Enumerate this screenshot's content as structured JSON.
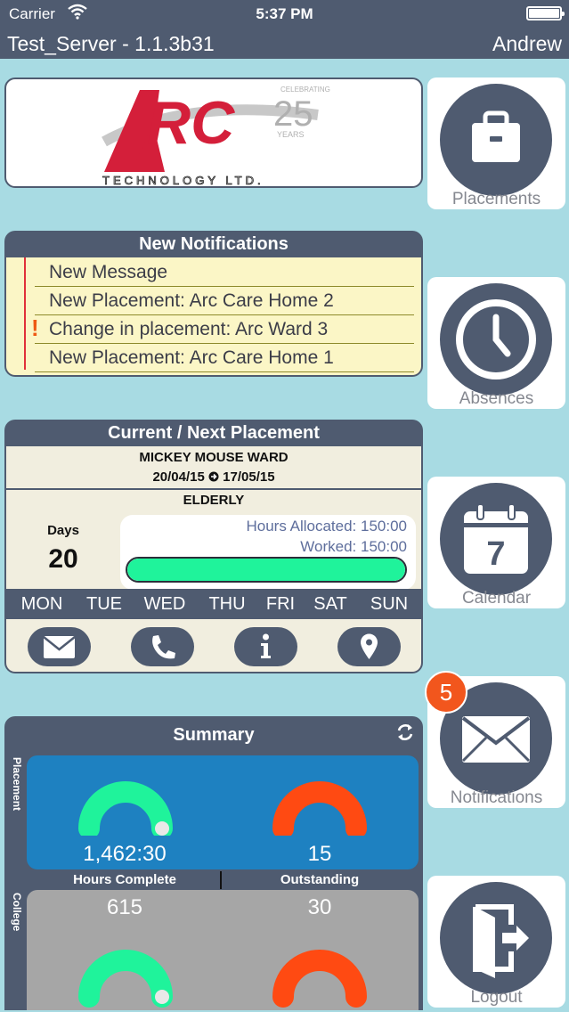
{
  "status": {
    "carrier": "Carrier",
    "time": "5:37 PM"
  },
  "header": {
    "server": "Test_Server - 1.1.3b31",
    "user": "Andrew"
  },
  "logo": {
    "letters": "ARC",
    "years": "25",
    "celebrating": "CELEBRATING",
    "years_word": "YEARS",
    "tagline": "TECHNOLOGY LTD."
  },
  "notifications": {
    "title": "New Notifications",
    "items": [
      {
        "text": "New Message",
        "flag": false
      },
      {
        "text": "New Placement: Arc Care Home 2",
        "flag": false
      },
      {
        "text": "Change in placement: Arc Ward 3",
        "flag": true
      },
      {
        "text": "New Placement: Arc Care Home 1",
        "flag": false
      }
    ],
    "flag_symbol": "!"
  },
  "placement": {
    "title": "Current / Next Placement",
    "ward": "MICKEY MOUSE WARD",
    "date_from": "20/04/15",
    "date_to": "17/05/15",
    "type": "ELDERLY",
    "days_label": "Days",
    "days_value": "20",
    "hours_allocated": "Hours Allocated: 150:00",
    "hours_worked": "Worked: 150:00",
    "progress_fraction": 1.0,
    "weekdays": [
      "MON",
      "TUE",
      "WED",
      "THU",
      "FRI",
      "SAT",
      "SUN"
    ],
    "actions": [
      "mail-icon",
      "phone-icon",
      "info-icon",
      "location-icon"
    ]
  },
  "summary": {
    "title": "Summary",
    "placement_label": "Placement",
    "college_label": "College",
    "hours_complete_label": "Hours Complete",
    "outstanding_label": "Outstanding",
    "placement_hours": "1,462:30",
    "placement_outstanding": "15",
    "college_hours": "615",
    "college_outstanding": "30"
  },
  "tiles": [
    {
      "label": "Placements",
      "icon": "briefcase-icon"
    },
    {
      "label": "Absences",
      "icon": "clock-icon"
    },
    {
      "label": "Calendar",
      "icon": "calendar-icon",
      "day": "7"
    },
    {
      "label": "Notifications",
      "icon": "envelope-icon",
      "badge": "5"
    },
    {
      "label": "Logout",
      "icon": "logout-icon"
    }
  ],
  "colors": {
    "navy": "#4f5b70",
    "background": "#a8dbe3",
    "green": "#1ff39b",
    "orange": "#ff4a12",
    "blue": "#1e81c1",
    "grey": "#a6a6a6",
    "badge": "#f2561d",
    "arc_red": "#d41f3a"
  }
}
